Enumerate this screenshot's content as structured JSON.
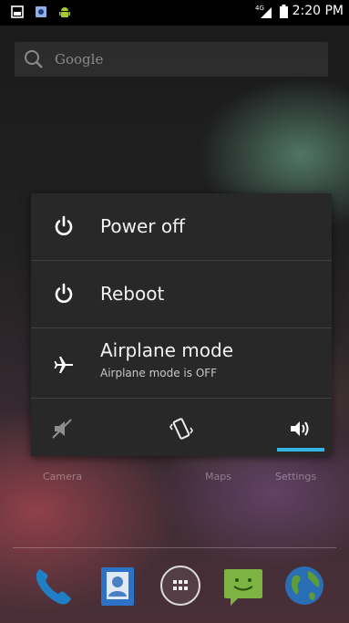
{
  "status_bar": {
    "time": "2:20 PM",
    "network_label": "4G",
    "left_icons": [
      "picture-notification-icon",
      "app-notification-icon",
      "android-notification-icon"
    ],
    "right_icons": [
      "signal-icon",
      "battery-icon"
    ]
  },
  "search": {
    "placeholder": "Google",
    "icon": "search-icon"
  },
  "power_menu": {
    "items": [
      {
        "label": "Power off",
        "icon": "power-icon"
      },
      {
        "label": "Reboot",
        "icon": "power-icon"
      },
      {
        "label": "Airplane mode",
        "sublabel": "Airplane mode is OFF",
        "icon": "airplane-icon"
      }
    ],
    "sound_modes": [
      {
        "icon": "silent-icon",
        "selected": false
      },
      {
        "icon": "vibrate-icon",
        "selected": false
      },
      {
        "icon": "sound-on-icon",
        "selected": true
      }
    ],
    "accent_color": "#33b5e5"
  },
  "home_labels": [
    "Camera",
    "Maps",
    "Settings"
  ],
  "dock": [
    {
      "icon": "phone-icon"
    },
    {
      "icon": "contacts-icon"
    },
    {
      "icon": "app-drawer-icon"
    },
    {
      "icon": "messaging-icon"
    },
    {
      "icon": "browser-icon"
    }
  ]
}
